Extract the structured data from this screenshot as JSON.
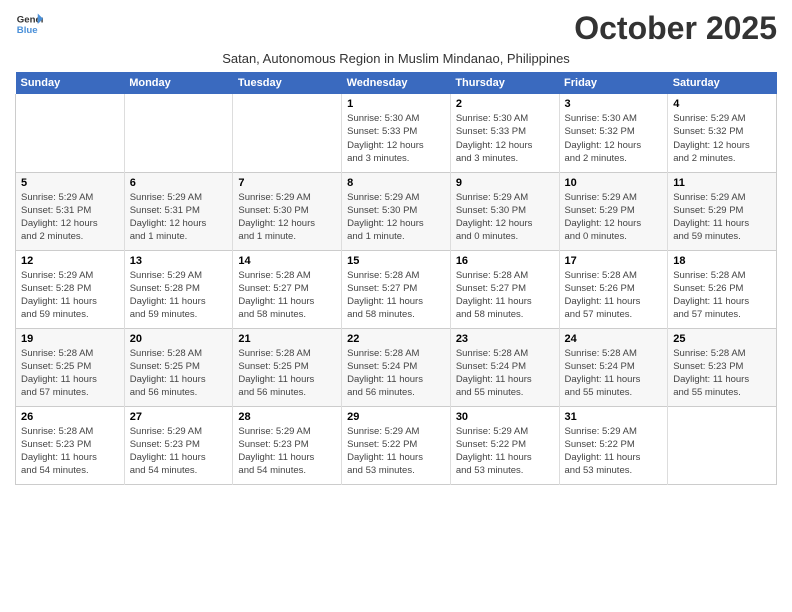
{
  "logo": {
    "general": "General",
    "blue": "Blue"
  },
  "title": "October 2025",
  "subtitle": "Satan, Autonomous Region in Muslim Mindanao, Philippines",
  "headers": [
    "Sunday",
    "Monday",
    "Tuesday",
    "Wednesday",
    "Thursday",
    "Friday",
    "Saturday"
  ],
  "weeks": [
    [
      {
        "day": "",
        "info": ""
      },
      {
        "day": "",
        "info": ""
      },
      {
        "day": "",
        "info": ""
      },
      {
        "day": "1",
        "info": "Sunrise: 5:30 AM\nSunset: 5:33 PM\nDaylight: 12 hours\nand 3 minutes."
      },
      {
        "day": "2",
        "info": "Sunrise: 5:30 AM\nSunset: 5:33 PM\nDaylight: 12 hours\nand 3 minutes."
      },
      {
        "day": "3",
        "info": "Sunrise: 5:30 AM\nSunset: 5:32 PM\nDaylight: 12 hours\nand 2 minutes."
      },
      {
        "day": "4",
        "info": "Sunrise: 5:29 AM\nSunset: 5:32 PM\nDaylight: 12 hours\nand 2 minutes."
      }
    ],
    [
      {
        "day": "5",
        "info": "Sunrise: 5:29 AM\nSunset: 5:31 PM\nDaylight: 12 hours\nand 2 minutes."
      },
      {
        "day": "6",
        "info": "Sunrise: 5:29 AM\nSunset: 5:31 PM\nDaylight: 12 hours\nand 1 minute."
      },
      {
        "day": "7",
        "info": "Sunrise: 5:29 AM\nSunset: 5:30 PM\nDaylight: 12 hours\nand 1 minute."
      },
      {
        "day": "8",
        "info": "Sunrise: 5:29 AM\nSunset: 5:30 PM\nDaylight: 12 hours\nand 1 minute."
      },
      {
        "day": "9",
        "info": "Sunrise: 5:29 AM\nSunset: 5:30 PM\nDaylight: 12 hours\nand 0 minutes."
      },
      {
        "day": "10",
        "info": "Sunrise: 5:29 AM\nSunset: 5:29 PM\nDaylight: 12 hours\nand 0 minutes."
      },
      {
        "day": "11",
        "info": "Sunrise: 5:29 AM\nSunset: 5:29 PM\nDaylight: 11 hours\nand 59 minutes."
      }
    ],
    [
      {
        "day": "12",
        "info": "Sunrise: 5:29 AM\nSunset: 5:28 PM\nDaylight: 11 hours\nand 59 minutes."
      },
      {
        "day": "13",
        "info": "Sunrise: 5:29 AM\nSunset: 5:28 PM\nDaylight: 11 hours\nand 59 minutes."
      },
      {
        "day": "14",
        "info": "Sunrise: 5:28 AM\nSunset: 5:27 PM\nDaylight: 11 hours\nand 58 minutes."
      },
      {
        "day": "15",
        "info": "Sunrise: 5:28 AM\nSunset: 5:27 PM\nDaylight: 11 hours\nand 58 minutes."
      },
      {
        "day": "16",
        "info": "Sunrise: 5:28 AM\nSunset: 5:27 PM\nDaylight: 11 hours\nand 58 minutes."
      },
      {
        "day": "17",
        "info": "Sunrise: 5:28 AM\nSunset: 5:26 PM\nDaylight: 11 hours\nand 57 minutes."
      },
      {
        "day": "18",
        "info": "Sunrise: 5:28 AM\nSunset: 5:26 PM\nDaylight: 11 hours\nand 57 minutes."
      }
    ],
    [
      {
        "day": "19",
        "info": "Sunrise: 5:28 AM\nSunset: 5:25 PM\nDaylight: 11 hours\nand 57 minutes."
      },
      {
        "day": "20",
        "info": "Sunrise: 5:28 AM\nSunset: 5:25 PM\nDaylight: 11 hours\nand 56 minutes."
      },
      {
        "day": "21",
        "info": "Sunrise: 5:28 AM\nSunset: 5:25 PM\nDaylight: 11 hours\nand 56 minutes."
      },
      {
        "day": "22",
        "info": "Sunrise: 5:28 AM\nSunset: 5:24 PM\nDaylight: 11 hours\nand 56 minutes."
      },
      {
        "day": "23",
        "info": "Sunrise: 5:28 AM\nSunset: 5:24 PM\nDaylight: 11 hours\nand 55 minutes."
      },
      {
        "day": "24",
        "info": "Sunrise: 5:28 AM\nSunset: 5:24 PM\nDaylight: 11 hours\nand 55 minutes."
      },
      {
        "day": "25",
        "info": "Sunrise: 5:28 AM\nSunset: 5:23 PM\nDaylight: 11 hours\nand 55 minutes."
      }
    ],
    [
      {
        "day": "26",
        "info": "Sunrise: 5:28 AM\nSunset: 5:23 PM\nDaylight: 11 hours\nand 54 minutes."
      },
      {
        "day": "27",
        "info": "Sunrise: 5:29 AM\nSunset: 5:23 PM\nDaylight: 11 hours\nand 54 minutes."
      },
      {
        "day": "28",
        "info": "Sunrise: 5:29 AM\nSunset: 5:23 PM\nDaylight: 11 hours\nand 54 minutes."
      },
      {
        "day": "29",
        "info": "Sunrise: 5:29 AM\nSunset: 5:22 PM\nDaylight: 11 hours\nand 53 minutes."
      },
      {
        "day": "30",
        "info": "Sunrise: 5:29 AM\nSunset: 5:22 PM\nDaylight: 11 hours\nand 53 minutes."
      },
      {
        "day": "31",
        "info": "Sunrise: 5:29 AM\nSunset: 5:22 PM\nDaylight: 11 hours\nand 53 minutes."
      },
      {
        "day": "",
        "info": ""
      }
    ]
  ]
}
